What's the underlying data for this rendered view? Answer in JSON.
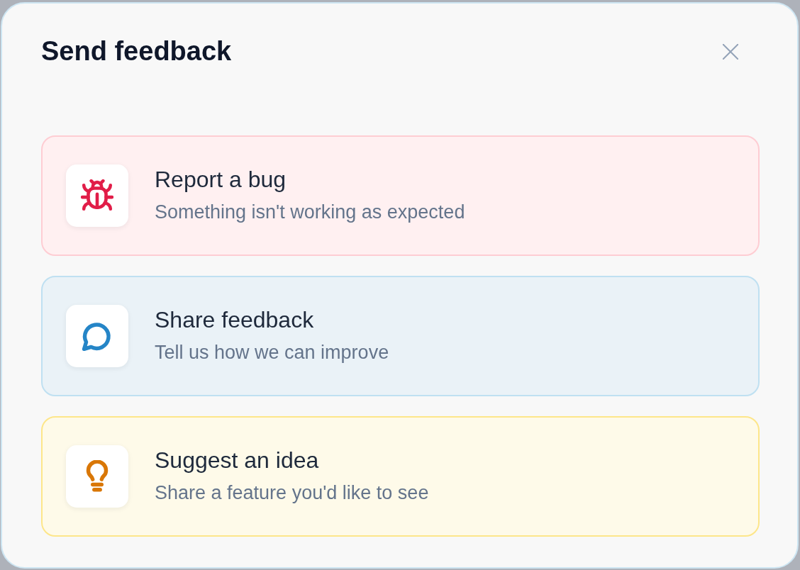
{
  "dialog": {
    "title": "Send feedback"
  },
  "options": [
    {
      "kind": "bug",
      "title": "Report a bug",
      "description": "Something isn't working as expected",
      "color": "#e11d48"
    },
    {
      "kind": "feedback",
      "title": "Share feedback",
      "description": "Tell us how we can improve",
      "color": "#2585c7"
    },
    {
      "kind": "idea",
      "title": "Suggest an idea",
      "description": "Share a feature you'd like to see",
      "color": "#d97706"
    }
  ]
}
